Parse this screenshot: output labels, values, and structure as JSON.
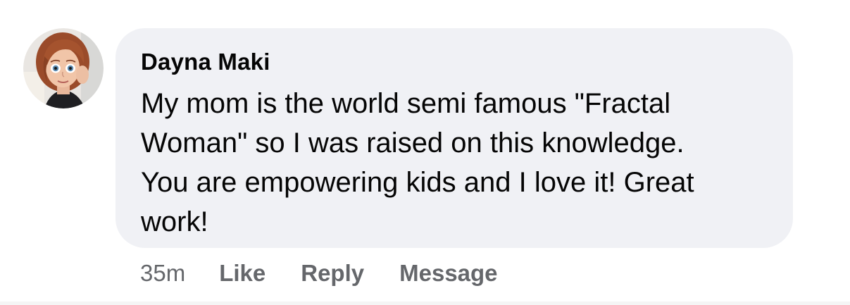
{
  "comment": {
    "author": "Dayna Maki",
    "text": "My mom is the world semi famous \"Fractal\nWoman\" so I was raised on this knowledge.\nYou are empowering kids and I love it! Great\nwork!",
    "timestamp": "35m",
    "actions": {
      "like": "Like",
      "reply": "Reply",
      "message": "Message"
    }
  },
  "icons": {
    "avatar": "avatar-image"
  },
  "colors": {
    "bubble_bg": "#f0f1f5",
    "text": "#050505",
    "secondary_text": "#65676b"
  }
}
